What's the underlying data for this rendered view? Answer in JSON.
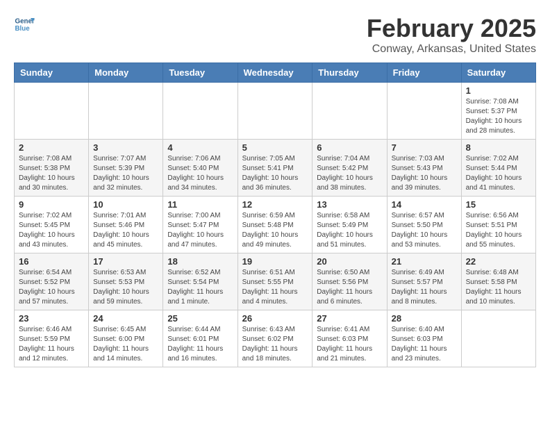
{
  "header": {
    "logo_line1": "General",
    "logo_line2": "Blue",
    "title": "February 2025",
    "subtitle": "Conway, Arkansas, United States"
  },
  "weekdays": [
    "Sunday",
    "Monday",
    "Tuesday",
    "Wednesday",
    "Thursday",
    "Friday",
    "Saturday"
  ],
  "weeks": [
    [
      {
        "day": "",
        "info": ""
      },
      {
        "day": "",
        "info": ""
      },
      {
        "day": "",
        "info": ""
      },
      {
        "day": "",
        "info": ""
      },
      {
        "day": "",
        "info": ""
      },
      {
        "day": "",
        "info": ""
      },
      {
        "day": "1",
        "info": "Sunrise: 7:08 AM\nSunset: 5:37 PM\nDaylight: 10 hours and 28 minutes."
      }
    ],
    [
      {
        "day": "2",
        "info": "Sunrise: 7:08 AM\nSunset: 5:38 PM\nDaylight: 10 hours and 30 minutes."
      },
      {
        "day": "3",
        "info": "Sunrise: 7:07 AM\nSunset: 5:39 PM\nDaylight: 10 hours and 32 minutes."
      },
      {
        "day": "4",
        "info": "Sunrise: 7:06 AM\nSunset: 5:40 PM\nDaylight: 10 hours and 34 minutes."
      },
      {
        "day": "5",
        "info": "Sunrise: 7:05 AM\nSunset: 5:41 PM\nDaylight: 10 hours and 36 minutes."
      },
      {
        "day": "6",
        "info": "Sunrise: 7:04 AM\nSunset: 5:42 PM\nDaylight: 10 hours and 38 minutes."
      },
      {
        "day": "7",
        "info": "Sunrise: 7:03 AM\nSunset: 5:43 PM\nDaylight: 10 hours and 39 minutes."
      },
      {
        "day": "8",
        "info": "Sunrise: 7:02 AM\nSunset: 5:44 PM\nDaylight: 10 hours and 41 minutes."
      }
    ],
    [
      {
        "day": "9",
        "info": "Sunrise: 7:02 AM\nSunset: 5:45 PM\nDaylight: 10 hours and 43 minutes."
      },
      {
        "day": "10",
        "info": "Sunrise: 7:01 AM\nSunset: 5:46 PM\nDaylight: 10 hours and 45 minutes."
      },
      {
        "day": "11",
        "info": "Sunrise: 7:00 AM\nSunset: 5:47 PM\nDaylight: 10 hours and 47 minutes."
      },
      {
        "day": "12",
        "info": "Sunrise: 6:59 AM\nSunset: 5:48 PM\nDaylight: 10 hours and 49 minutes."
      },
      {
        "day": "13",
        "info": "Sunrise: 6:58 AM\nSunset: 5:49 PM\nDaylight: 10 hours and 51 minutes."
      },
      {
        "day": "14",
        "info": "Sunrise: 6:57 AM\nSunset: 5:50 PM\nDaylight: 10 hours and 53 minutes."
      },
      {
        "day": "15",
        "info": "Sunrise: 6:56 AM\nSunset: 5:51 PM\nDaylight: 10 hours and 55 minutes."
      }
    ],
    [
      {
        "day": "16",
        "info": "Sunrise: 6:54 AM\nSunset: 5:52 PM\nDaylight: 10 hours and 57 minutes."
      },
      {
        "day": "17",
        "info": "Sunrise: 6:53 AM\nSunset: 5:53 PM\nDaylight: 10 hours and 59 minutes."
      },
      {
        "day": "18",
        "info": "Sunrise: 6:52 AM\nSunset: 5:54 PM\nDaylight: 11 hours and 1 minute."
      },
      {
        "day": "19",
        "info": "Sunrise: 6:51 AM\nSunset: 5:55 PM\nDaylight: 11 hours and 4 minutes."
      },
      {
        "day": "20",
        "info": "Sunrise: 6:50 AM\nSunset: 5:56 PM\nDaylight: 11 hours and 6 minutes."
      },
      {
        "day": "21",
        "info": "Sunrise: 6:49 AM\nSunset: 5:57 PM\nDaylight: 11 hours and 8 minutes."
      },
      {
        "day": "22",
        "info": "Sunrise: 6:48 AM\nSunset: 5:58 PM\nDaylight: 11 hours and 10 minutes."
      }
    ],
    [
      {
        "day": "23",
        "info": "Sunrise: 6:46 AM\nSunset: 5:59 PM\nDaylight: 11 hours and 12 minutes."
      },
      {
        "day": "24",
        "info": "Sunrise: 6:45 AM\nSunset: 6:00 PM\nDaylight: 11 hours and 14 minutes."
      },
      {
        "day": "25",
        "info": "Sunrise: 6:44 AM\nSunset: 6:01 PM\nDaylight: 11 hours and 16 minutes."
      },
      {
        "day": "26",
        "info": "Sunrise: 6:43 AM\nSunset: 6:02 PM\nDaylight: 11 hours and 18 minutes."
      },
      {
        "day": "27",
        "info": "Sunrise: 6:41 AM\nSunset: 6:03 PM\nDaylight: 11 hours and 21 minutes."
      },
      {
        "day": "28",
        "info": "Sunrise: 6:40 AM\nSunset: 6:03 PM\nDaylight: 11 hours and 23 minutes."
      },
      {
        "day": "",
        "info": ""
      }
    ]
  ]
}
